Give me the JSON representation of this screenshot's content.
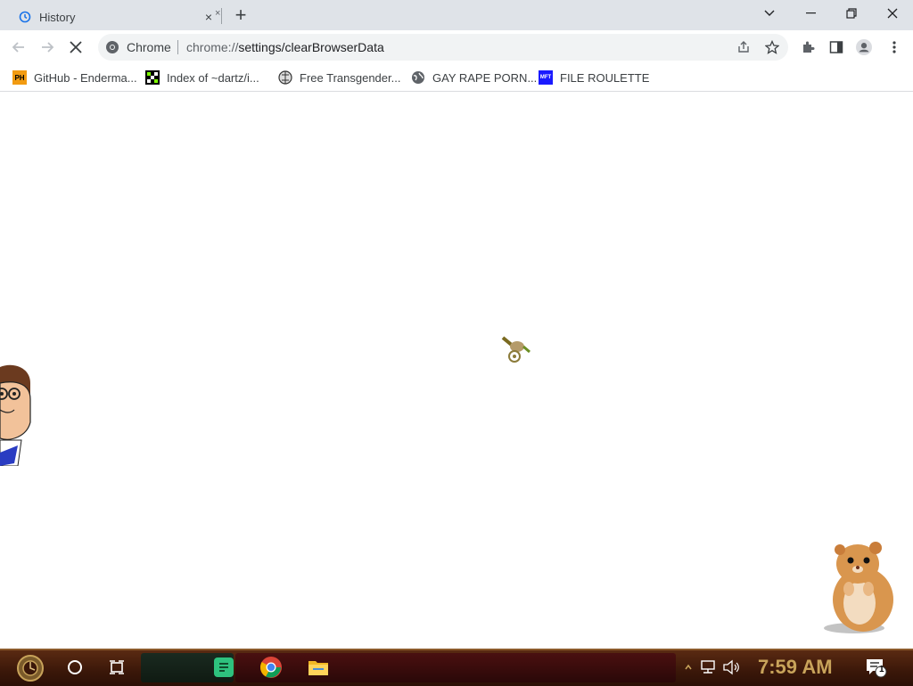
{
  "browser": {
    "tab": {
      "title": "History",
      "close": "×"
    },
    "new_tab": "+",
    "window_controls": [
      "minimize",
      "restore",
      "close"
    ]
  },
  "toolbar": {
    "site_label": "Chrome",
    "url_prefix": "chrome://",
    "url_path": "settings/clearBrowserData"
  },
  "bookmarks": [
    {
      "label": "GitHub - Enderma...",
      "icon": "ph-icon",
      "badge": "PH"
    },
    {
      "label": "Index of ~dartz/i...",
      "icon": "checker-icon",
      "badge": ""
    },
    {
      "label": "Free Transgender...",
      "icon": "puzzle-globe-icon",
      "badge": ""
    },
    {
      "label": "GAY RAPE PORN...",
      "icon": "globe-icon",
      "badge": ""
    },
    {
      "label": "FILE ROULETTE",
      "icon": "mft-icon",
      "badge": "MFT"
    }
  ],
  "taskbar": {
    "clock": "7:59 AM",
    "notification_count": "1"
  },
  "colors": {
    "tabstrip": "#dfe3e8",
    "omnibox": "#f1f3f4",
    "taskbar": "#3a1709",
    "clock": "#c8a35a"
  }
}
